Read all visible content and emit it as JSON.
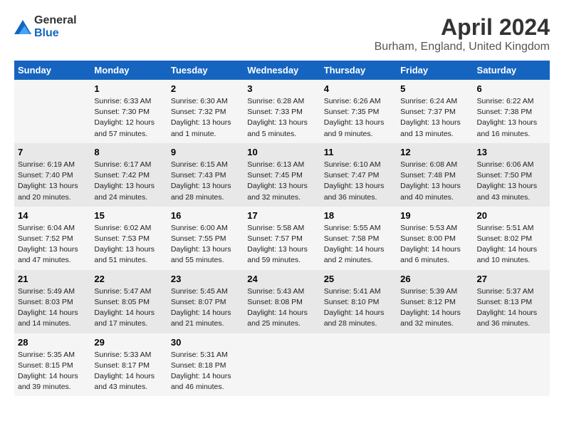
{
  "header": {
    "logo_general": "General",
    "logo_blue": "Blue",
    "title": "April 2024",
    "subtitle": "Burham, England, United Kingdom"
  },
  "calendar": {
    "headers": [
      "Sunday",
      "Monday",
      "Tuesday",
      "Wednesday",
      "Thursday",
      "Friday",
      "Saturday"
    ],
    "weeks": [
      [
        {
          "day": "",
          "info": ""
        },
        {
          "day": "1",
          "info": "Sunrise: 6:33 AM\nSunset: 7:30 PM\nDaylight: 12 hours\nand 57 minutes."
        },
        {
          "day": "2",
          "info": "Sunrise: 6:30 AM\nSunset: 7:32 PM\nDaylight: 13 hours\nand 1 minute."
        },
        {
          "day": "3",
          "info": "Sunrise: 6:28 AM\nSunset: 7:33 PM\nDaylight: 13 hours\nand 5 minutes."
        },
        {
          "day": "4",
          "info": "Sunrise: 6:26 AM\nSunset: 7:35 PM\nDaylight: 13 hours\nand 9 minutes."
        },
        {
          "day": "5",
          "info": "Sunrise: 6:24 AM\nSunset: 7:37 PM\nDaylight: 13 hours\nand 13 minutes."
        },
        {
          "day": "6",
          "info": "Sunrise: 6:22 AM\nSunset: 7:38 PM\nDaylight: 13 hours\nand 16 minutes."
        }
      ],
      [
        {
          "day": "7",
          "info": "Sunrise: 6:19 AM\nSunset: 7:40 PM\nDaylight: 13 hours\nand 20 minutes."
        },
        {
          "day": "8",
          "info": "Sunrise: 6:17 AM\nSunset: 7:42 PM\nDaylight: 13 hours\nand 24 minutes."
        },
        {
          "day": "9",
          "info": "Sunrise: 6:15 AM\nSunset: 7:43 PM\nDaylight: 13 hours\nand 28 minutes."
        },
        {
          "day": "10",
          "info": "Sunrise: 6:13 AM\nSunset: 7:45 PM\nDaylight: 13 hours\nand 32 minutes."
        },
        {
          "day": "11",
          "info": "Sunrise: 6:10 AM\nSunset: 7:47 PM\nDaylight: 13 hours\nand 36 minutes."
        },
        {
          "day": "12",
          "info": "Sunrise: 6:08 AM\nSunset: 7:48 PM\nDaylight: 13 hours\nand 40 minutes."
        },
        {
          "day": "13",
          "info": "Sunrise: 6:06 AM\nSunset: 7:50 PM\nDaylight: 13 hours\nand 43 minutes."
        }
      ],
      [
        {
          "day": "14",
          "info": "Sunrise: 6:04 AM\nSunset: 7:52 PM\nDaylight: 13 hours\nand 47 minutes."
        },
        {
          "day": "15",
          "info": "Sunrise: 6:02 AM\nSunset: 7:53 PM\nDaylight: 13 hours\nand 51 minutes."
        },
        {
          "day": "16",
          "info": "Sunrise: 6:00 AM\nSunset: 7:55 PM\nDaylight: 13 hours\nand 55 minutes."
        },
        {
          "day": "17",
          "info": "Sunrise: 5:58 AM\nSunset: 7:57 PM\nDaylight: 13 hours\nand 59 minutes."
        },
        {
          "day": "18",
          "info": "Sunrise: 5:55 AM\nSunset: 7:58 PM\nDaylight: 14 hours\nand 2 minutes."
        },
        {
          "day": "19",
          "info": "Sunrise: 5:53 AM\nSunset: 8:00 PM\nDaylight: 14 hours\nand 6 minutes."
        },
        {
          "day": "20",
          "info": "Sunrise: 5:51 AM\nSunset: 8:02 PM\nDaylight: 14 hours\nand 10 minutes."
        }
      ],
      [
        {
          "day": "21",
          "info": "Sunrise: 5:49 AM\nSunset: 8:03 PM\nDaylight: 14 hours\nand 14 minutes."
        },
        {
          "day": "22",
          "info": "Sunrise: 5:47 AM\nSunset: 8:05 PM\nDaylight: 14 hours\nand 17 minutes."
        },
        {
          "day": "23",
          "info": "Sunrise: 5:45 AM\nSunset: 8:07 PM\nDaylight: 14 hours\nand 21 minutes."
        },
        {
          "day": "24",
          "info": "Sunrise: 5:43 AM\nSunset: 8:08 PM\nDaylight: 14 hours\nand 25 minutes."
        },
        {
          "day": "25",
          "info": "Sunrise: 5:41 AM\nSunset: 8:10 PM\nDaylight: 14 hours\nand 28 minutes."
        },
        {
          "day": "26",
          "info": "Sunrise: 5:39 AM\nSunset: 8:12 PM\nDaylight: 14 hours\nand 32 minutes."
        },
        {
          "day": "27",
          "info": "Sunrise: 5:37 AM\nSunset: 8:13 PM\nDaylight: 14 hours\nand 36 minutes."
        }
      ],
      [
        {
          "day": "28",
          "info": "Sunrise: 5:35 AM\nSunset: 8:15 PM\nDaylight: 14 hours\nand 39 minutes."
        },
        {
          "day": "29",
          "info": "Sunrise: 5:33 AM\nSunset: 8:17 PM\nDaylight: 14 hours\nand 43 minutes."
        },
        {
          "day": "30",
          "info": "Sunrise: 5:31 AM\nSunset: 8:18 PM\nDaylight: 14 hours\nand 46 minutes."
        },
        {
          "day": "",
          "info": ""
        },
        {
          "day": "",
          "info": ""
        },
        {
          "day": "",
          "info": ""
        },
        {
          "day": "",
          "info": ""
        }
      ]
    ]
  }
}
